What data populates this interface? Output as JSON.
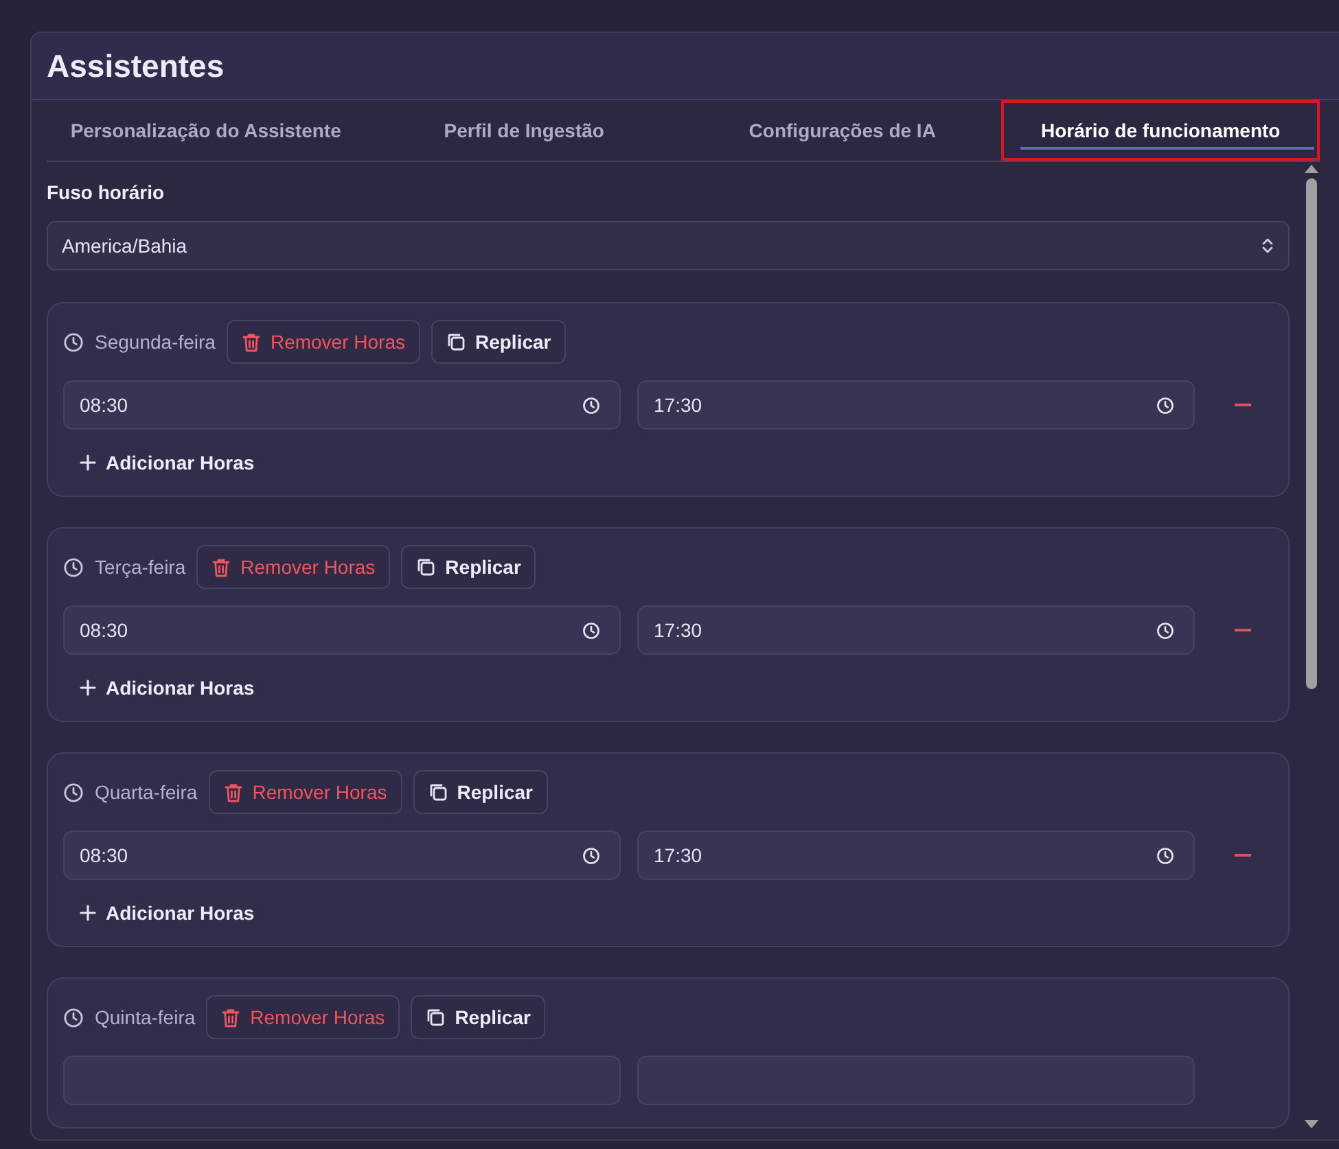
{
  "title": "Assistentes",
  "tabs": [
    {
      "label": "Personalização do Assistente",
      "selected": false,
      "highlighted": false
    },
    {
      "label": "Perfil de Ingestão",
      "selected": false,
      "highlighted": false
    },
    {
      "label": "Configurações de IA",
      "selected": false,
      "highlighted": false
    },
    {
      "label": "Horário de funcionamento",
      "selected": true,
      "highlighted": true
    }
  ],
  "timezone": {
    "label": "Fuso horário",
    "value": "America/Bahia"
  },
  "days": [
    {
      "name": "Segunda-feira",
      "remove_label": "Remover Horas",
      "replicate_label": "Replicar",
      "slots": [
        {
          "start": "08:30",
          "end": "17:30"
        }
      ],
      "add_label": "Adicionar Horas",
      "cut_off": false
    },
    {
      "name": "Terça-feira",
      "remove_label": "Remover Horas",
      "replicate_label": "Replicar",
      "slots": [
        {
          "start": "08:30",
          "end": "17:30"
        }
      ],
      "add_label": "Adicionar Horas",
      "cut_off": false
    },
    {
      "name": "Quarta-feira",
      "remove_label": "Remover Horas",
      "replicate_label": "Replicar",
      "slots": [
        {
          "start": "08:30",
          "end": "17:30"
        }
      ],
      "add_label": "Adicionar Horas",
      "cut_off": false
    },
    {
      "name": "Quinta-feira",
      "remove_label": "Remover Horas",
      "replicate_label": "Replicar",
      "cut_off": true
    }
  ]
}
